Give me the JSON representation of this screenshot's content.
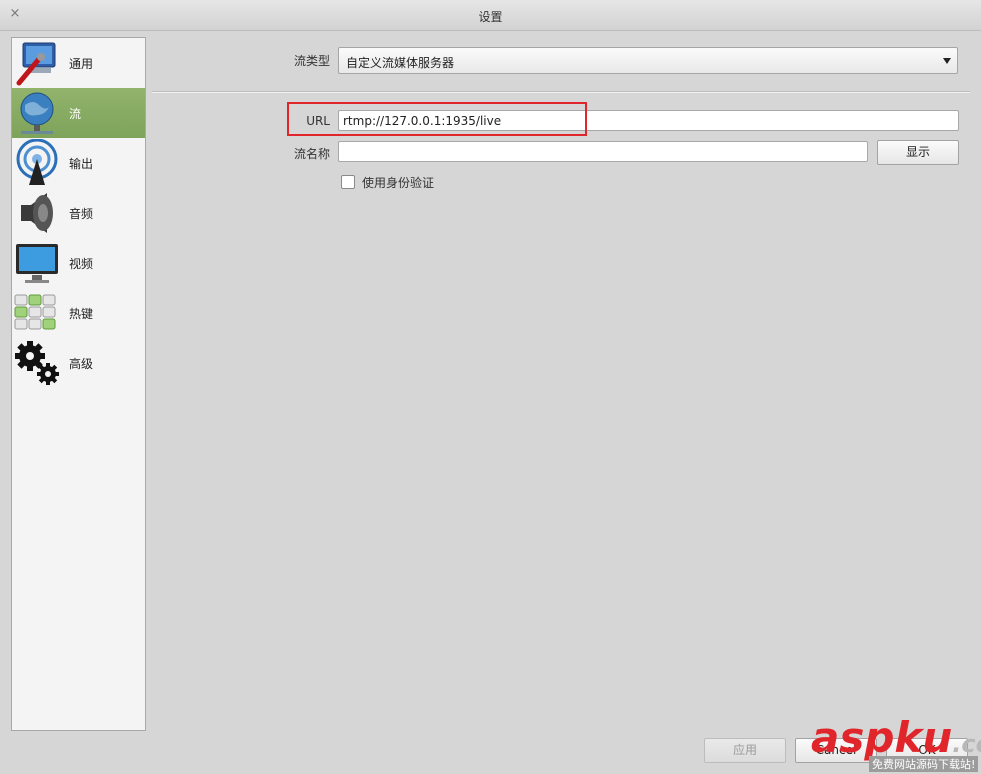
{
  "window": {
    "title": "设置",
    "close_glyph": "×"
  },
  "sidebar": {
    "items": [
      {
        "label": "通用",
        "icon": "general-settings-icon",
        "selected": false
      },
      {
        "label": "流",
        "icon": "stream-globe-icon",
        "selected": true
      },
      {
        "label": "输出",
        "icon": "output-broadcast-icon",
        "selected": false
      },
      {
        "label": "音频",
        "icon": "speaker-icon",
        "selected": false
      },
      {
        "label": "视频",
        "icon": "monitor-icon",
        "selected": false
      },
      {
        "label": "热键",
        "icon": "hotkeys-keyboard-icon",
        "selected": false
      },
      {
        "label": "高级",
        "icon": "gears-icon",
        "selected": false
      }
    ]
  },
  "stream": {
    "type_label": "流类型",
    "type_value": "自定义流媒体服务器",
    "url_label": "URL",
    "url_value": "rtmp://127.0.0.1:1935/live",
    "key_label": "流名称",
    "key_value": "",
    "show_button": "显示",
    "auth_label": "使用身份验证",
    "auth_checked": false
  },
  "footer": {
    "apply_label": "应用",
    "cancel_label": "Cancel",
    "ok_label": "OK"
  },
  "watermark": {
    "main": "aspku",
    "suffix": ".com",
    "sub": "免费网站源码下载站!"
  },
  "colors": {
    "selected_bg": "#8aac63",
    "highlight_border": "#e0262b"
  }
}
